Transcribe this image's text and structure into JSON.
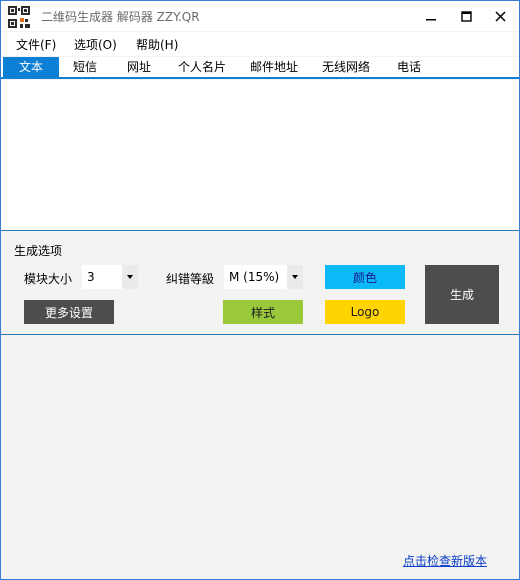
{
  "window": {
    "title": "二维码生成器 解码器 ZZY.QR"
  },
  "menu": [
    {
      "label": "文件(F)"
    },
    {
      "label": "选项(O)"
    },
    {
      "label": "帮助(H)"
    }
  ],
  "tabs": [
    {
      "label": "文本",
      "active": true
    },
    {
      "label": "短信"
    },
    {
      "label": "网址"
    },
    {
      "label": "个人名片"
    },
    {
      "label": "邮件地址"
    },
    {
      "label": "无线网络"
    },
    {
      "label": "电话"
    }
  ],
  "text_input": {
    "value": ""
  },
  "options": {
    "title": "生成选项",
    "module_size_label": "模块大小",
    "module_size_value": "3",
    "ecc_label": "纠错等級",
    "ecc_value": "M (15%)",
    "color_button": "颜色",
    "style_button": "样式",
    "logo_button": "Logo",
    "more_button": "更多设置",
    "generate_button": "生成"
  },
  "footer": {
    "update_link": "点击检查新版本"
  },
  "colors": {
    "accent": "#0d7fd4",
    "color_button": "#0ab9f5",
    "style_button": "#99c93b",
    "logo_button": "#ffd400",
    "dark_button": "#4d4d4d"
  }
}
